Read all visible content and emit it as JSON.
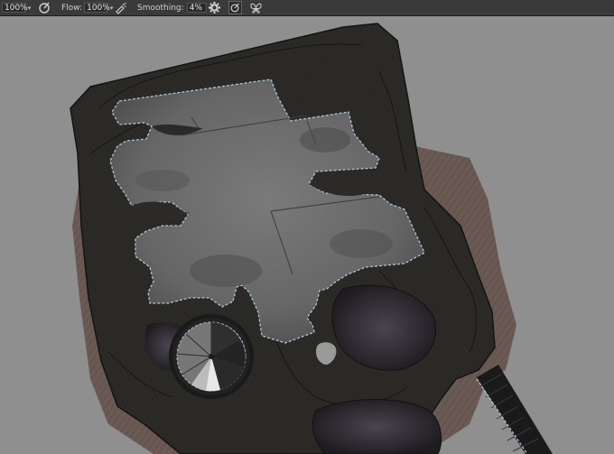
{
  "toolbar": {
    "opacity": {
      "value": "100%"
    },
    "flow": {
      "label": "Flow:",
      "value": "100%"
    },
    "smoothing": {
      "label": "Smoothing:",
      "value": "4%"
    }
  },
  "icons": {
    "pressure_opacity": "pressure-opacity-icon",
    "airbrush": "airbrush-icon",
    "smoothing_settings": "gear-icon",
    "pressure_size": "pressure-size-icon",
    "symmetry": "butterfly-icon"
  },
  "colors": {
    "canvas_bg": "#8f8f8f",
    "rock": "#2b2a27",
    "floor": "#6e6e6e",
    "earth": "#6b5a54",
    "dashed_border": "#a9c7d6"
  }
}
